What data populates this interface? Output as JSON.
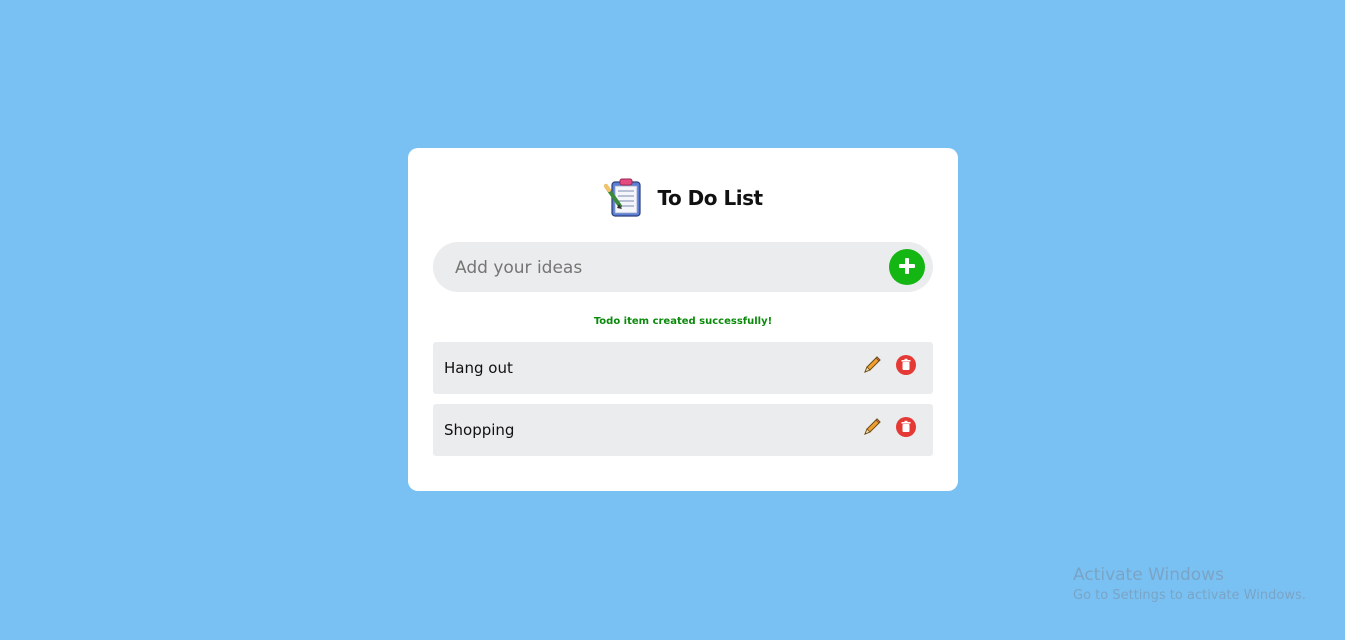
{
  "app": {
    "title": "To Do List",
    "logo_icon": "clipboard-checklist-icon"
  },
  "input": {
    "placeholder": "Add your ideas",
    "value": "",
    "add_icon": "plus-icon"
  },
  "status": {
    "message": "Todo item created successfully!",
    "color": "#0a8a0a"
  },
  "todos": [
    {
      "text": "Hang out",
      "edit_icon": "pencil-icon",
      "delete_icon": "trash-icon"
    },
    {
      "text": "Shopping",
      "edit_icon": "pencil-icon",
      "delete_icon": "trash-icon"
    }
  ],
  "colors": {
    "background": "#7ac1f3",
    "card": "#ffffff",
    "accent_add": "#13b613",
    "delete": "#e53935",
    "edit": "#f0a030"
  },
  "watermark": {
    "title": "Activate Windows",
    "subtitle": "Go to Settings to activate Windows."
  }
}
